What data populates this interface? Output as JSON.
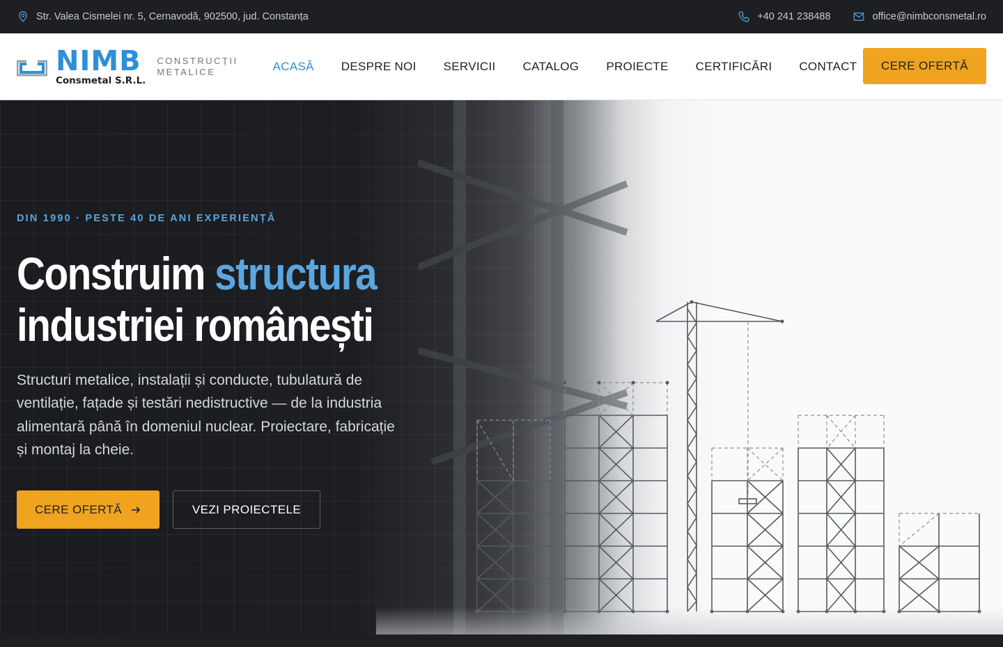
{
  "topbar": {
    "address": "Str. Valea Cismelei nr. 5, Cernavodă, 902500, jud. Constanța",
    "phone": "+40 241 238488",
    "email": "office@nimbconsmetal.ro"
  },
  "logo": {
    "name": "NIMB",
    "company": "Consmetal S.R.L.",
    "tagline_1": "CONSTRUCȚII",
    "tagline_2": "METALICE"
  },
  "nav": {
    "items": [
      {
        "label": "ACASĂ",
        "active": true
      },
      {
        "label": "DESPRE NOI"
      },
      {
        "label": "SERVICII"
      },
      {
        "label": "CATALOG"
      },
      {
        "label": "PROIECTE"
      },
      {
        "label": "CERTIFICĂRI"
      },
      {
        "label": "CONTACT"
      }
    ],
    "cta": "CERE OFERTĂ"
  },
  "hero": {
    "eyebrow": "DIN 1990 · PESTE 40 DE ANI EXPERIENȚĂ",
    "title_part1": "Construim ",
    "title_accent": "structura",
    "title_line2": "industriei românești",
    "description": "Structuri metalice, instalații și conducte, tubulatură de ventilație, fațade și testări nedistructive — de la industria alimentară până în domeniul nuclear. Proiectare, fabricație și montaj la cheie.",
    "primary_button": "CERE OFERTĂ",
    "secondary_button": "VEZI PROIECTELE"
  },
  "colors": {
    "accent_blue": "#2f8fd4",
    "accent_orange": "#f0a31f",
    "dark": "#1d1f23"
  }
}
